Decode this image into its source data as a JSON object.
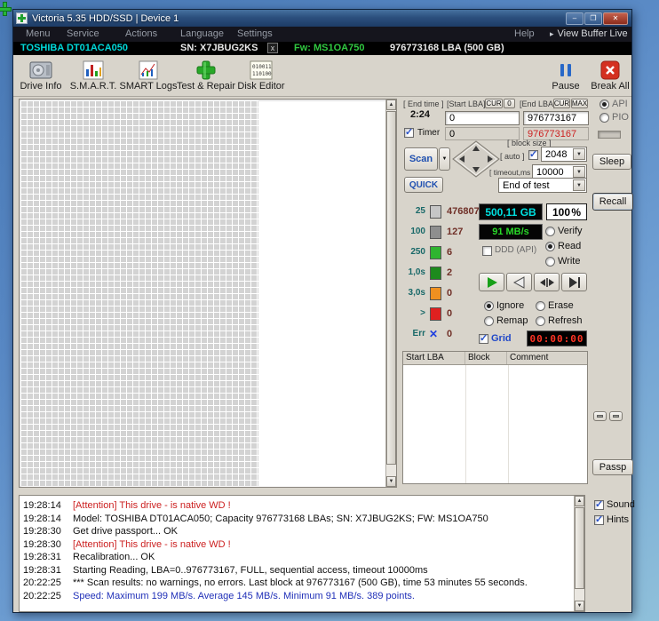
{
  "colors": {
    "model_cyan": "#00d8d8",
    "firmware_green": "#30c840",
    "capacity_cyan": "#00e0e0",
    "speed_green": "#28d828",
    "timer_red": "#ff3424",
    "value_red": "#cc2020",
    "grid_blue": "#2048c8"
  },
  "icons": {
    "dropdown_arrow": "▼",
    "scroll_up": "▲",
    "scroll_down": "▼",
    "view_buffer": "▸",
    "minimize": "–",
    "maximize": "❐",
    "close_x": "✕"
  },
  "window": {
    "title": "Victoria 5.35 HDD/SSD | Device 1"
  },
  "menubar": {
    "items": [
      "Menu",
      "Service",
      "Actions",
      "Language",
      "Settings"
    ],
    "help": "Help",
    "view_buffer_live": "View Buffer Live"
  },
  "drive_bar": {
    "model": "TOSHIBA DT01ACA050",
    "serial": "SN: X7JBUG2KS",
    "close_label": "x",
    "firmware": "Fw: MS1OA750",
    "capacity": "976773168 LBA (500 GB)"
  },
  "toolbar": {
    "buttons": [
      {
        "label": "Drive Info"
      },
      {
        "label": "S.M.A.R.T."
      },
      {
        "label": "SMART Logs"
      },
      {
        "label": "Test & Repair"
      },
      {
        "label": "Disk Editor"
      }
    ],
    "pause": "Pause",
    "break_all": "Break All"
  },
  "scan_panel": {
    "end_time_label": "[ End time ]",
    "end_time": "2:24",
    "start_lba_label": "[Start LBA]",
    "cur_label": "CUR",
    "zero_label": "0",
    "end_lba_label": "[End LBA]",
    "max_label": "MAX",
    "start_lba": "0",
    "end_lba": "976773167",
    "timer_label": "Timer",
    "timer_count": "0",
    "timer_end": "976773167",
    "scan_label": "Scan",
    "quick_label": "QUICK",
    "block_size_label": "[ block size ]",
    "auto_label": "[ auto ]",
    "block_size": "2048",
    "timeout_label": "[ timeout,ms ]",
    "timeout": "10000",
    "end_of_test": "End of test",
    "stats": [
      {
        "label": "25",
        "value": "476807",
        "color": "#c6c6c6"
      },
      {
        "label": "100",
        "value": "127",
        "color": "#8e8e8e"
      },
      {
        "label": "250",
        "value": "6",
        "color": "#2fb42f"
      },
      {
        "label": "1,0s",
        "value": "2",
        "color": "#1d8a1d"
      },
      {
        "label": "3,0s",
        "value": "0",
        "color": "#f09020"
      },
      {
        "label": ">",
        "value": "0",
        "color": "#df2020"
      },
      {
        "label": "Err",
        "value": "0",
        "color": "#2040e0",
        "symbol": "✕"
      }
    ],
    "capacity_display": "500,11 GB",
    "percent_value": "100",
    "percent_sign": "%",
    "speed_display": "91 MB/s",
    "ddd_label": "DDD (API)",
    "verify_label": "Verify",
    "read_label": "Read",
    "write_label": "Write",
    "ignore_label": "Ignore",
    "erase_label": "Erase",
    "remap_label": "Remap",
    "refresh_label": "Refresh",
    "grid_label": "Grid",
    "grid_timer": "00:00:00",
    "table_headers": [
      "Start LBA",
      "Block",
      "Comment"
    ]
  },
  "side_panel": {
    "api_label": "API",
    "pio_label": "PIO",
    "sleep_label": "Sleep",
    "recall_label": "Recall",
    "passp_label": "Passp"
  },
  "log": {
    "entries": [
      {
        "time": "19:28:14",
        "text": "[Attention] This drive - is native WD !",
        "color": "#cc2020"
      },
      {
        "time": "19:28:14",
        "text": "Model: TOSHIBA DT01ACA050; Capacity 976773168 LBAs; SN: X7JBUG2KS; FW: MS1OA750",
        "color": "#101010"
      },
      {
        "time": "19:28:30",
        "text": "Get drive passport... OK",
        "color": "#101010"
      },
      {
        "time": "19:28:30",
        "text": "[Attention] This drive - is native WD !",
        "color": "#cc2020"
      },
      {
        "time": "19:28:31",
        "text": "Recalibration... OK",
        "color": "#101010"
      },
      {
        "time": "19:28:31",
        "text": "Starting Reading, LBA=0..976773167, FULL, sequential access, timeout 10000ms",
        "color": "#101010"
      },
      {
        "time": "20:22:25",
        "text": "*** Scan results: no warnings, no errors. Last block at 976773167 (500 GB), time 53 minutes 55 seconds.",
        "color": "#101010"
      },
      {
        "time": "20:22:25",
        "text": "Speed: Maximum 199 MB/s. Average 145 MB/s. Minimum 91 MB/s. 389 points.",
        "color": "#2030b8"
      }
    ],
    "sound_label": "Sound",
    "hints_label": "Hints"
  }
}
